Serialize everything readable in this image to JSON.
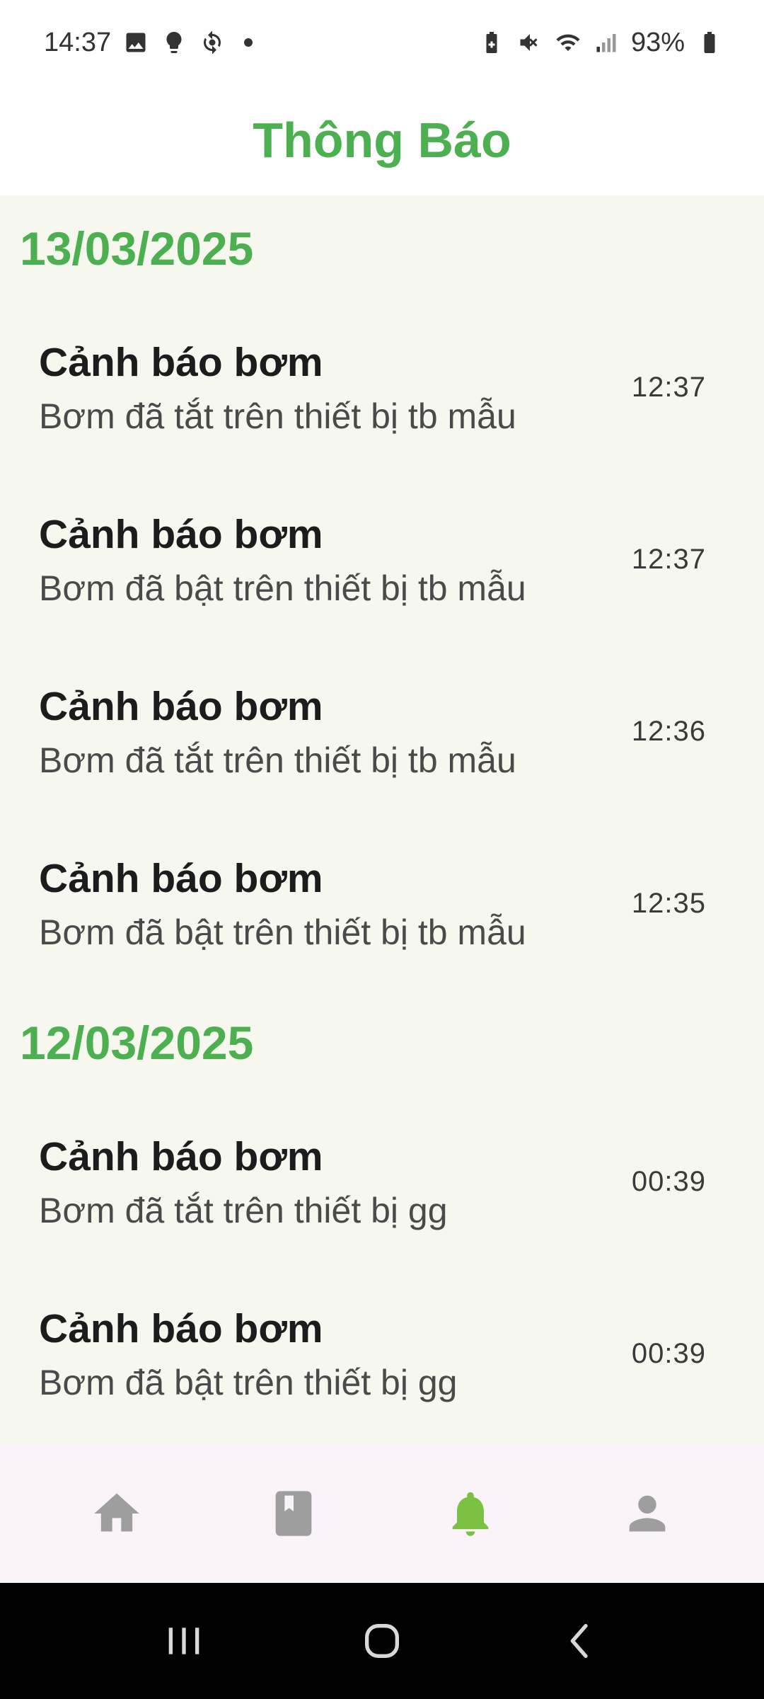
{
  "status_bar": {
    "time": "14:37",
    "left_icons": [
      "image-icon",
      "bulb-icon",
      "sync-icon"
    ],
    "right_icons": [
      "battery-saver-icon",
      "mute-icon",
      "wifi-icon",
      "signal-icon"
    ],
    "battery_percent": "93%"
  },
  "header": {
    "title": "Thông Báo",
    "title_color": "#4caf50"
  },
  "notifications": {
    "groups": [
      {
        "date": "13/03/2025",
        "items": [
          {
            "title": "Cảnh báo bơm",
            "body": "Bơm đã tắt trên thiết bị tb mẫu",
            "time": "12:37"
          },
          {
            "title": "Cảnh báo bơm",
            "body": "Bơm đã bật trên thiết bị tb mẫu",
            "time": "12:37"
          },
          {
            "title": "Cảnh báo bơm",
            "body": "Bơm đã tắt trên thiết bị tb mẫu",
            "time": "12:36"
          },
          {
            "title": "Cảnh báo bơm",
            "body": "Bơm đã bật trên thiết bị tb mẫu",
            "time": "12:35"
          }
        ]
      },
      {
        "date": "12/03/2025",
        "items": [
          {
            "title": "Cảnh báo bơm",
            "body": "Bơm đã tắt trên thiết bị gg",
            "time": "00:39"
          },
          {
            "title": "Cảnh báo bơm",
            "body": "Bơm đã bật trên thiết bị gg",
            "time": "00:39"
          }
        ]
      }
    ]
  },
  "bottom_nav": {
    "items": [
      {
        "icon": "home-icon",
        "active": false
      },
      {
        "icon": "book-icon",
        "active": false
      },
      {
        "icon": "bell-icon",
        "active": true
      },
      {
        "icon": "person-icon",
        "active": false
      }
    ],
    "active_color": "#7cc242",
    "inactive_color": "#9e9e9e"
  },
  "system_nav": {
    "items": [
      "recents-icon",
      "home-circle-icon",
      "back-icon"
    ]
  }
}
